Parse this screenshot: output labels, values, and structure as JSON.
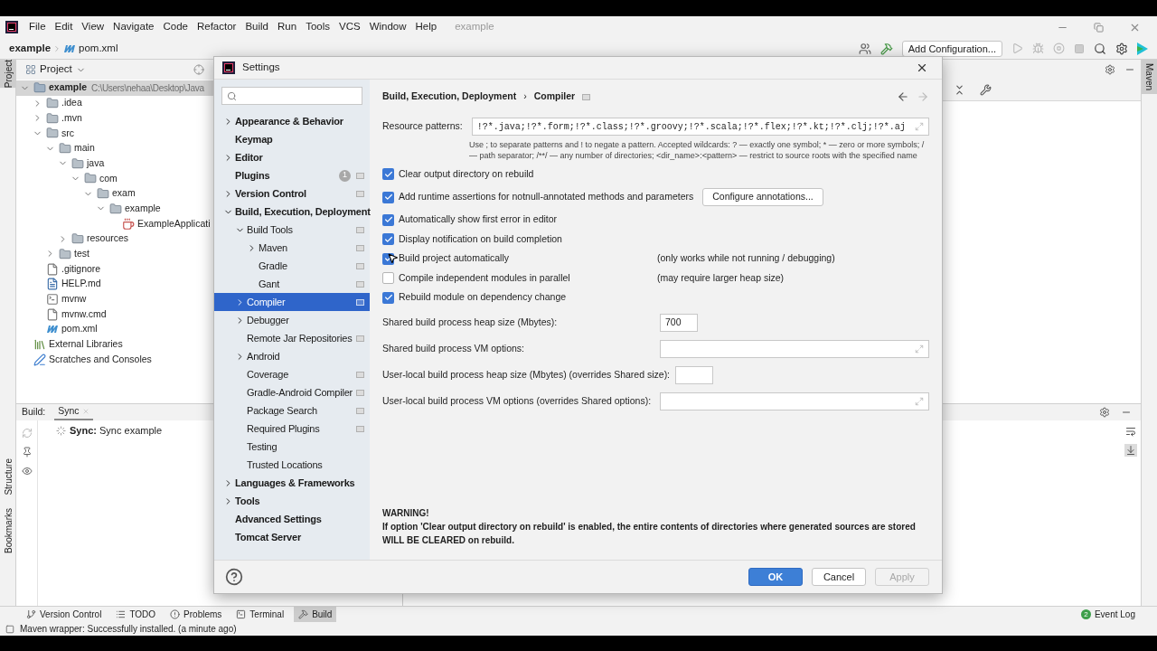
{
  "menu_bar": {
    "items": [
      "File",
      "Edit",
      "View",
      "Navigate",
      "Code",
      "Refactor",
      "Build",
      "Run",
      "Tools",
      "VCS",
      "Window",
      "Help"
    ],
    "project_title": "example"
  },
  "nav_bar": {
    "breadcrumb": [
      "example",
      "pom.xml"
    ],
    "run_config": "Add Configuration..."
  },
  "left_stripe": [
    {
      "label": "Project",
      "selected": true
    },
    {
      "label": "Structure",
      "selected": false
    },
    {
      "label": "Bookmarks",
      "selected": false
    }
  ],
  "right_stripe": [
    {
      "label": "Maven",
      "selected": true
    }
  ],
  "project_panel": {
    "title": "Project",
    "tree": [
      {
        "label": "example",
        "path": "C:\\Users\\nehaa\\Desktop\\Java",
        "kind": "module",
        "expanded": true,
        "selected": true,
        "children": [
          {
            "label": ".idea",
            "kind": "folder",
            "expanded": false,
            "selected": false
          },
          {
            "label": ".mvn",
            "kind": "folder",
            "expanded": false,
            "selected": false
          },
          {
            "label": "src",
            "kind": "folder",
            "expanded": true,
            "selected": false,
            "children": [
              {
                "label": "main",
                "kind": "folder",
                "expanded": true,
                "selected": false,
                "children": [
                  {
                    "label": "java",
                    "kind": "folder",
                    "expanded": true,
                    "selected": false,
                    "children": [
                      {
                        "label": "com",
                        "kind": "folder",
                        "expanded": true,
                        "selected": false,
                        "children": [
                          {
                            "label": "exam",
                            "kind": "folder",
                            "expanded": true,
                            "selected": false,
                            "children": [
                              {
                                "label": "example",
                                "kind": "folder",
                                "expanded": true,
                                "selected": false,
                                "children": [
                                  {
                                    "label": "ExampleApplicati",
                                    "kind": "class",
                                    "selected": false
                                  }
                                ]
                              }
                            ]
                          }
                        ]
                      }
                    ]
                  },
                  {
                    "label": "resources",
                    "kind": "folder",
                    "expanded": false,
                    "selected": false
                  }
                ]
              },
              {
                "label": "test",
                "kind": "folder",
                "expanded": false,
                "selected": false
              }
            ]
          },
          {
            "label": ".gitignore",
            "kind": "file",
            "selected": false
          },
          {
            "label": "HELP.md",
            "kind": "markdown",
            "selected": false
          },
          {
            "label": "mvnw",
            "kind": "script",
            "selected": false
          },
          {
            "label": "mvnw.cmd",
            "kind": "file",
            "selected": false
          },
          {
            "label": "pom.xml",
            "kind": "maven",
            "selected": false
          }
        ]
      },
      {
        "label": "External Libraries",
        "kind": "library",
        "selected": false
      },
      {
        "label": "Scratches and Consoles",
        "kind": "scratch",
        "selected": false
      }
    ]
  },
  "build_panel": {
    "label": "Build:",
    "tabs": [
      {
        "label": "Sync",
        "selected": true
      }
    ],
    "rows": [
      {
        "title": "Sync:",
        "text": "Sync example"
      }
    ]
  },
  "bottom_tools": [
    {
      "label": "Version Control",
      "kind": "branch",
      "selected": false
    },
    {
      "label": "TODO",
      "kind": "list",
      "selected": false
    },
    {
      "label": "Problems",
      "kind": "problems",
      "selected": false
    },
    {
      "label": "Terminal",
      "kind": "terminal",
      "selected": false
    },
    {
      "label": "Build",
      "kind": "hammer",
      "selected": true
    }
  ],
  "event_log": {
    "label": "Event Log",
    "badge": "2"
  },
  "status_bar": "Maven wrapper: Successfully installed. (a minute ago)",
  "dialog": {
    "title": "Settings",
    "sidebar": [
      {
        "label": "Appearance & Behavior",
        "expanded": false,
        "project_level": false,
        "selected": false
      },
      {
        "label": "Keymap",
        "project_level": false,
        "selected": false
      },
      {
        "label": "Editor",
        "expanded": false,
        "project_level": false,
        "selected": false
      },
      {
        "label": "Plugins",
        "badge": "1",
        "project_level": true,
        "selected": false
      },
      {
        "label": "Version Control",
        "expanded": false,
        "project_level": true,
        "selected": false
      },
      {
        "label": "Build, Execution, Deployment",
        "expanded": true,
        "project_level": false,
        "selected": false,
        "children": [
          {
            "label": "Build Tools",
            "expanded": true,
            "project_level": true,
            "selected": false,
            "children": [
              {
                "label": "Maven",
                "expanded": false,
                "project_level": true,
                "selected": false
              },
              {
                "label": "Gradle",
                "project_level": true,
                "selected": false
              },
              {
                "label": "Gant",
                "project_level": true,
                "selected": false
              }
            ]
          },
          {
            "label": "Compiler",
            "expanded": false,
            "project_level": true,
            "selected": true
          },
          {
            "label": "Debugger",
            "expanded": false,
            "project_level": false,
            "selected": false
          },
          {
            "label": "Remote Jar Repositories",
            "project_level": true,
            "selected": false
          },
          {
            "label": "Android",
            "expanded": false,
            "project_level": false,
            "selected": false
          },
          {
            "label": "Coverage",
            "project_level": true,
            "selected": false
          },
          {
            "label": "Gradle-Android Compiler",
            "project_level": true,
            "selected": false
          },
          {
            "label": "Package Search",
            "project_level": true,
            "selected": false
          },
          {
            "label": "Required Plugins",
            "project_level": true,
            "selected": false
          },
          {
            "label": "Testing",
            "project_level": false,
            "selected": false
          },
          {
            "label": "Trusted Locations",
            "project_level": false,
            "selected": false
          }
        ]
      },
      {
        "label": "Languages & Frameworks",
        "expanded": false,
        "project_level": false,
        "selected": false
      },
      {
        "label": "Tools",
        "expanded": false,
        "project_level": false,
        "selected": false
      },
      {
        "label": "Advanced Settings",
        "project_level": false,
        "selected": false
      },
      {
        "label": "Tomcat Server",
        "project_level": false,
        "selected": false
      }
    ],
    "breadcrumb": [
      "Build, Execution, Deployment",
      "Compiler"
    ],
    "breadcrumb_separator": "›",
    "resource_patterns": {
      "label": "Resource patterns:",
      "value": "!?*.java;!?*.form;!?*.class;!?*.groovy;!?*.scala;!?*.flex;!?*.kt;!?*.clj;!?*.aj",
      "hint": "Use ; to separate patterns and ! to negate a pattern. Accepted wildcards: ? — exactly one symbol; * — zero or more symbols; / — path separator; /**/ — any number of directories; <dir_name>:<pattern> — restrict to source roots with the specified name"
    },
    "options": [
      {
        "kind": "checkbox",
        "label": "Clear output directory on rebuild",
        "checked": true
      },
      {
        "kind": "checkbox",
        "label": "Add runtime assertions for notnull-annotated methods and parameters",
        "checked": true,
        "button": "Configure annotations..."
      },
      {
        "kind": "checkbox",
        "label": "Automatically show first error in editor",
        "checked": true
      },
      {
        "kind": "checkbox",
        "label": "Display notification on build completion",
        "checked": true
      },
      {
        "kind": "checkbox",
        "label": "Build project automatically",
        "checked": true,
        "note": "(only works while not running / debugging)"
      },
      {
        "kind": "checkbox",
        "label": "Compile independent modules in parallel",
        "checked": false,
        "note": "(may require larger heap size)"
      },
      {
        "kind": "checkbox",
        "label": "Rebuild module on dependency change",
        "checked": true
      },
      {
        "kind": "field",
        "label": "Shared build process heap size (Mbytes):",
        "value": "700",
        "expandable": false
      },
      {
        "kind": "field",
        "label": "Shared build process VM options:",
        "expandable": true
      },
      {
        "kind": "field",
        "label": "User-local build process heap size (Mbytes) (overrides Shared size):",
        "expandable": false
      },
      {
        "kind": "field",
        "label": "User-local build process VM options (overrides Shared options):",
        "expandable": true
      }
    ],
    "warning": {
      "title": "WARNING!",
      "lines": [
        "If option 'Clear output directory on rebuild' is enabled, the entire contents of directories where generated sources are stored",
        "WILL BE CLEARED on rebuild."
      ]
    },
    "buttons": [
      {
        "label": "OK",
        "primary": true,
        "disabled": false
      },
      {
        "label": "Cancel",
        "primary": false,
        "disabled": false
      },
      {
        "label": "Apply",
        "primary": false,
        "disabled": true
      }
    ]
  }
}
